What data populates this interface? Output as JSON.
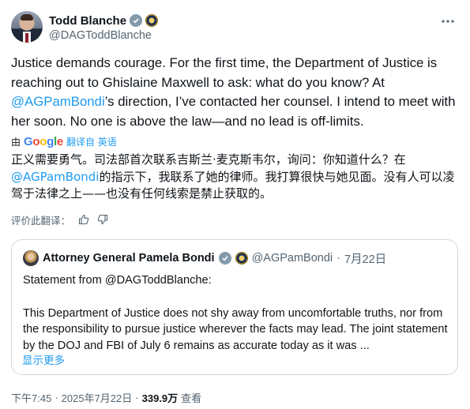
{
  "author": {
    "display_name": "Todd Blanche",
    "handle": "@DAGToddBlanche"
  },
  "tweet": {
    "text_before": "Justice demands courage. For the first time, the Department of Justice is reaching out to Ghislaine Maxwell to ask: what do you know? At ",
    "mention": "@AGPamBondi",
    "text_after": "’s direction, I’ve contacted her counsel. I intend to meet with her soon. No one is above the law—and no lead is off-limits."
  },
  "translation": {
    "by_prefix": "由",
    "google_letters": [
      "G",
      "o",
      "o",
      "g",
      "l",
      "e"
    ],
    "label": "翻译自 英语",
    "text_before": "正义需要勇气。司法部首次联系吉斯兰·麦克斯韦尔，询问：你知道什么？在",
    "mention": "@AGPamBondi",
    "text_after": "的指示下，我联系了她的律师。我打算很快与她见面。没有人可以凌驾于法律之上——也没有任何线索是禁止获取的。",
    "rate_label": "评价此翻译："
  },
  "quote": {
    "display_name": "Attorney General Pamela Bondi",
    "handle": "@AGPamBondi",
    "separator": "·",
    "date": "7月22日",
    "line1": "Statement from @DAGToddBlanche:",
    "body": "This Department of Justice does not shy away from uncomfortable truths, nor from the responsibility to pursue justice wherever the facts may lead.  The joint statement by the DOJ and FBI of July 6 remains as accurate today as it was ...",
    "show_more": "显示更多"
  },
  "footer": {
    "time": "下午7:45",
    "separator1": "·",
    "date": "2025年7月22日",
    "separator2": "·",
    "views": "339.9万",
    "views_label": "查看"
  },
  "icons": {
    "verified": "verified-badge-icon",
    "affiliation": "doj-seal-icon",
    "more": "more-horizontal-icon",
    "thumbs_up": "thumbs-up-icon",
    "thumbs_down": "thumbs-down-icon"
  },
  "colors": {
    "link": "#1d9bf0",
    "secondary_text": "#536471",
    "verified_badge": "#829aab",
    "border": "#cfd9de"
  }
}
